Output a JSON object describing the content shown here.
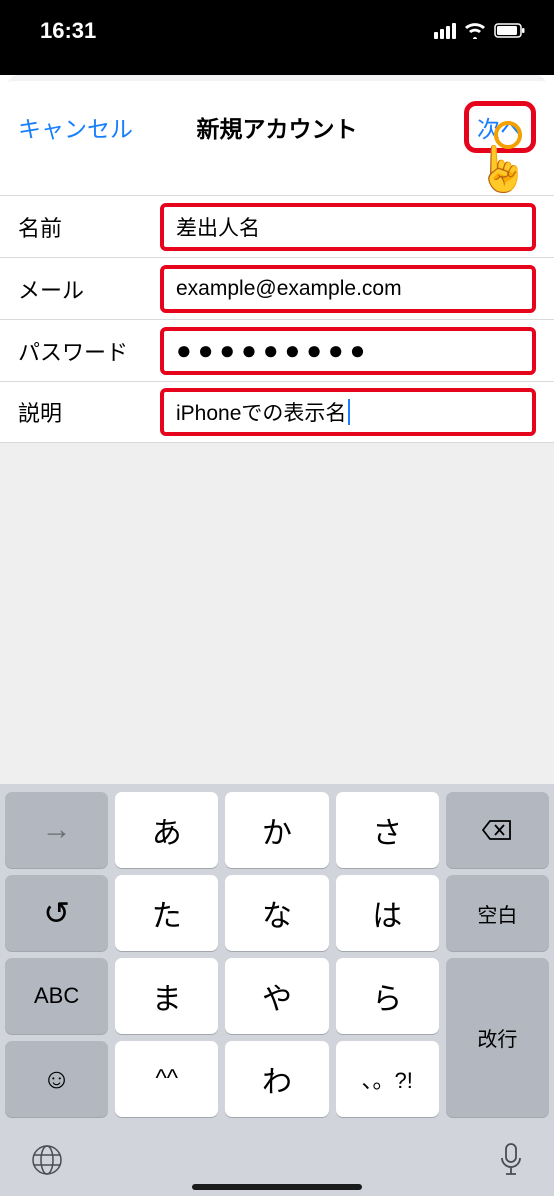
{
  "status": {
    "time": "16:31"
  },
  "nav": {
    "cancel": "キャンセル",
    "title": "新規アカウント",
    "next": "次へ"
  },
  "form": {
    "name_label": "名前",
    "name_value": "差出人名",
    "email_label": "メール",
    "email_value": "example@example.com",
    "password_label": "パスワード",
    "password_value": "●●●●●●●●●",
    "desc_label": "説明",
    "desc_value": "iPhoneでの表示名"
  },
  "keyboard": {
    "r1": {
      "k1": "→",
      "k2": "あ",
      "k3": "か",
      "k4": "さ",
      "k5": "⌫"
    },
    "r2": {
      "k1": "↺",
      "k2": "た",
      "k3": "な",
      "k4": "は",
      "k5": "空白"
    },
    "r3": {
      "k1": "ABC",
      "k2": "ま",
      "k3": "や",
      "k4": "ら",
      "k5": "改行"
    },
    "r4": {
      "k1": "☺",
      "k2": "^^",
      "k3": "わ",
      "k4": "、。?!"
    }
  }
}
